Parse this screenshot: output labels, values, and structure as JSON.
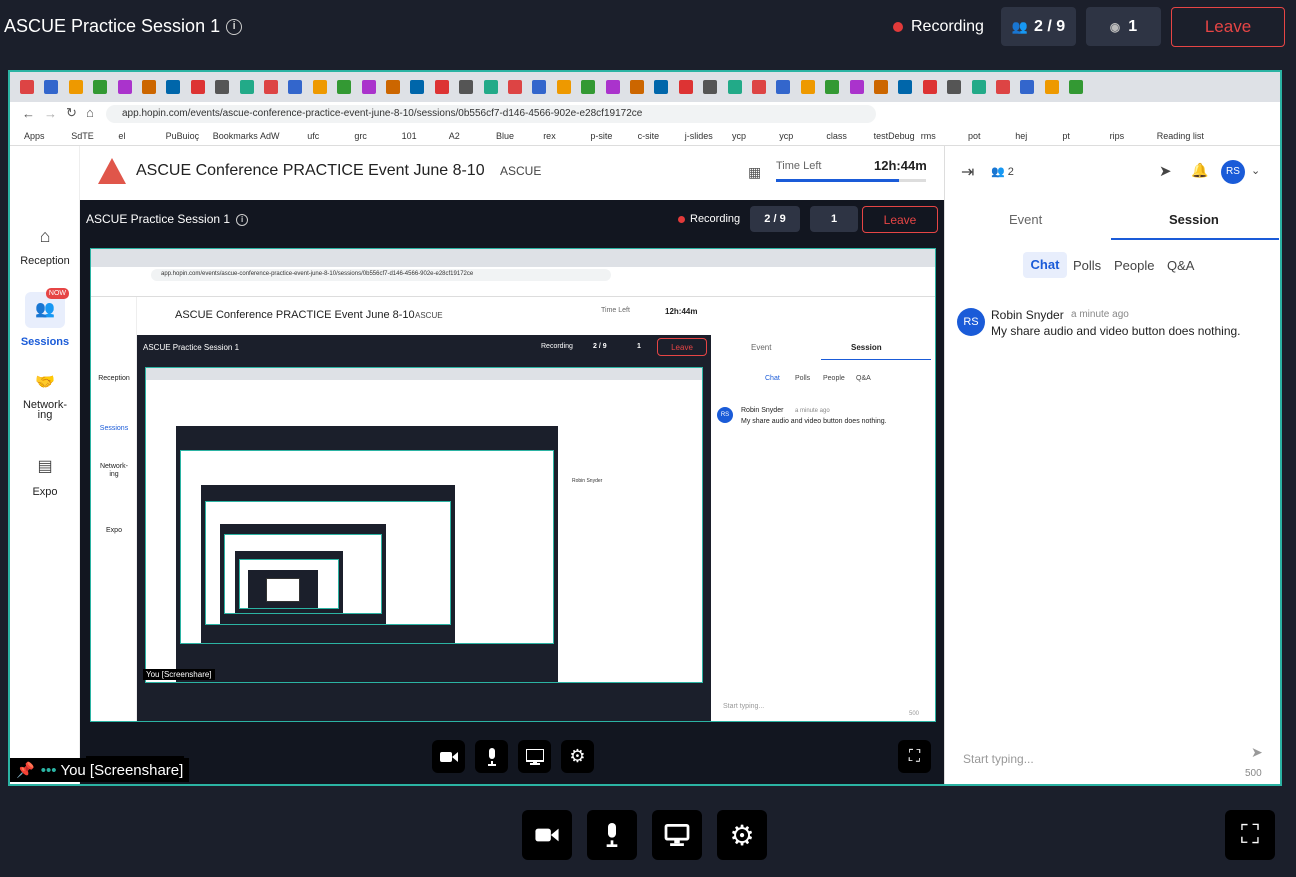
{
  "header": {
    "title": "ASCUE Practice Session 1",
    "recording": "Recording",
    "attendees": "2 / 9",
    "viewers": "1",
    "leave": "Leave"
  },
  "browser": {
    "url": "app.hopin.com/events/ascue-conference-practice-event-june-8-10/sessions/0b556cf7-d146-4566-902e-e28cf19172ce",
    "bookmarks": [
      "Apps",
      "SdTE",
      "el",
      "PuBuioç",
      "Bookmarks",
      "AdW",
      "ufc",
      "grc",
      "101",
      "A2",
      "Blue",
      "rex",
      "p-site",
      "c-site",
      "j-slides",
      "ycp",
      "ycp",
      "class",
      "testDebug",
      "rms",
      "pot",
      "hej",
      "pt",
      "rips",
      "Reading list"
    ]
  },
  "app": {
    "event_title": "ASCUE Conference PRACTICE Event June 8-10",
    "org": "ASCUE",
    "time_left_label": "Time Left",
    "time_left": "12h:44m",
    "nav": [
      {
        "label": "Reception"
      },
      {
        "label": "Sessions",
        "badge": "NOW"
      },
      {
        "label": "Network-\ning"
      },
      {
        "label": "Expo"
      }
    ],
    "stage_title": "ASCUE Practice Session 1",
    "recording": "Recording",
    "attendees": "2 / 9",
    "viewers": "1",
    "leave": "Leave",
    "panel": {
      "people_count": "2",
      "avatar": "RS",
      "tabs": [
        "Event",
        "Session"
      ],
      "subtabs": [
        "Chat",
        "Polls",
        "People",
        "Q&A"
      ],
      "message": {
        "author": "Robin Snyder",
        "time": "a minute ago",
        "text": "My share audio and video button does nothing."
      },
      "input_placeholder": "Start typing...",
      "char_limit": "500"
    },
    "screenshare_label": "You [Screenshare]"
  },
  "nested": {
    "stage_title": "ASCUE Practice Session 1",
    "recording": "Recording",
    "attendees": "2 / 9",
    "viewers": "1",
    "leave": "Leave",
    "url": "app.hopin.com/events/ascue-conference-practice-event-june-8-10/sessions/0b556cf7-d146-4566-902e-e28cf19172ce",
    "event_title": "ASCUE Conference PRACTICE Event June 8-10",
    "org": "ASCUE",
    "time_left_label": "Time Left",
    "time_left": "12h:44m",
    "nav": [
      "Reception",
      "Sessions",
      "Network-\ning",
      "Expo"
    ],
    "tabs": [
      "Event",
      "Session"
    ],
    "subtabs": [
      "Chat",
      "Polls",
      "People",
      "Q&A"
    ],
    "author": "Robin Snyder",
    "time": "a minute ago",
    "text": "My share audio and video button does nothing.",
    "placeholder": "Start typing...",
    "limit": "500",
    "screenshare": "You [Screenshare]"
  },
  "colors": {
    "accent": "#1a5bd8",
    "leave": "#e64545",
    "stage_bg": "#1b1f2b",
    "share_border": "#2bb3a3"
  }
}
